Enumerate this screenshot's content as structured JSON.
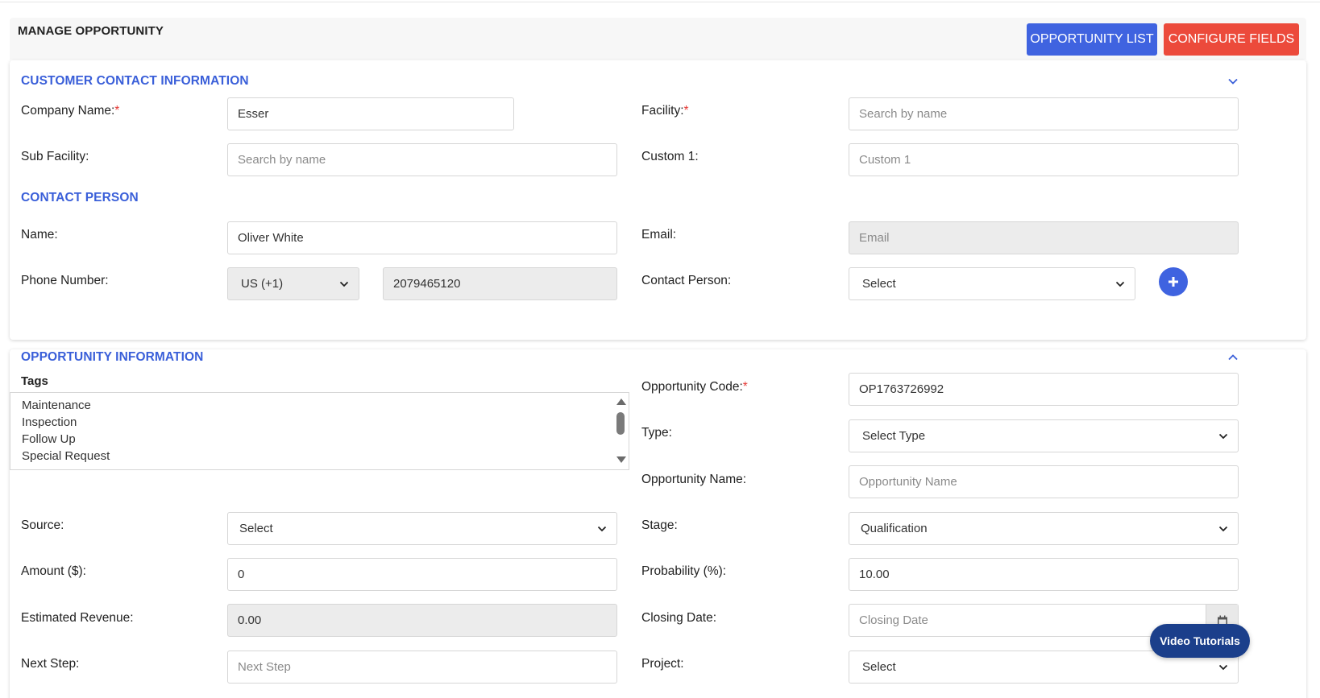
{
  "header": {
    "title": "MANAGE OPPORTUNITY",
    "opportunity_list_label": "OPPORTUNITY LIST",
    "configure_fields_label": "CONFIGURE FIELDS"
  },
  "customer_section": {
    "title": "CUSTOMER CONTACT INFORMATION",
    "company_name_label": "Company Name:",
    "company_name_value": "Esser",
    "facility_label": "Facility:",
    "facility_placeholder": "Search by name",
    "sub_facility_label": "Sub Facility:",
    "sub_facility_placeholder": "Search by name",
    "custom1_label": "Custom 1:",
    "custom1_placeholder": "Custom 1",
    "contact_person_title": "CONTACT PERSON",
    "name_label": "Name:",
    "name_value": "Oliver White",
    "email_label": "Email:",
    "email_placeholder": "Email",
    "phone_label": "Phone Number:",
    "phone_country": "US (+1)",
    "phone_value": "2079465120",
    "contact_person_label": "Contact Person:",
    "contact_person_value": "Select",
    "required_mark": "*"
  },
  "opportunity_section": {
    "title": "OPPORTUNITY INFORMATION",
    "tags_label": "Tags",
    "tags": [
      "Maintenance",
      "Inspection",
      "Follow Up",
      "Special Request"
    ],
    "code_label": "Opportunity Code:",
    "code_value": "OP1763726992",
    "type_label": "Type:",
    "type_value": "Select Type",
    "opp_name_label": "Opportunity Name:",
    "opp_name_placeholder": "Opportunity Name",
    "source_label": "Source:",
    "source_value": "Select",
    "stage_label": "Stage:",
    "stage_value": "Qualification",
    "amount_label": "Amount ($):",
    "amount_value": "0",
    "probability_label": "Probability (%):",
    "probability_value": "10.00",
    "est_revenue_label": "Estimated Revenue:",
    "est_revenue_value": "0.00",
    "closing_date_label": "Closing Date:",
    "closing_date_placeholder": "Closing Date",
    "next_step_label": "Next Step:",
    "next_step_placeholder": "Next Step",
    "project_label": "Project:",
    "project_value": "Select",
    "required_mark": "*"
  },
  "video_tutorials_label": "Video Tutorials",
  "colors": {
    "accent_blue": "#3f63e0",
    "accent_red": "#ec4a3b",
    "section_title": "#3a5fd9",
    "video_button": "#1b3f8b"
  }
}
